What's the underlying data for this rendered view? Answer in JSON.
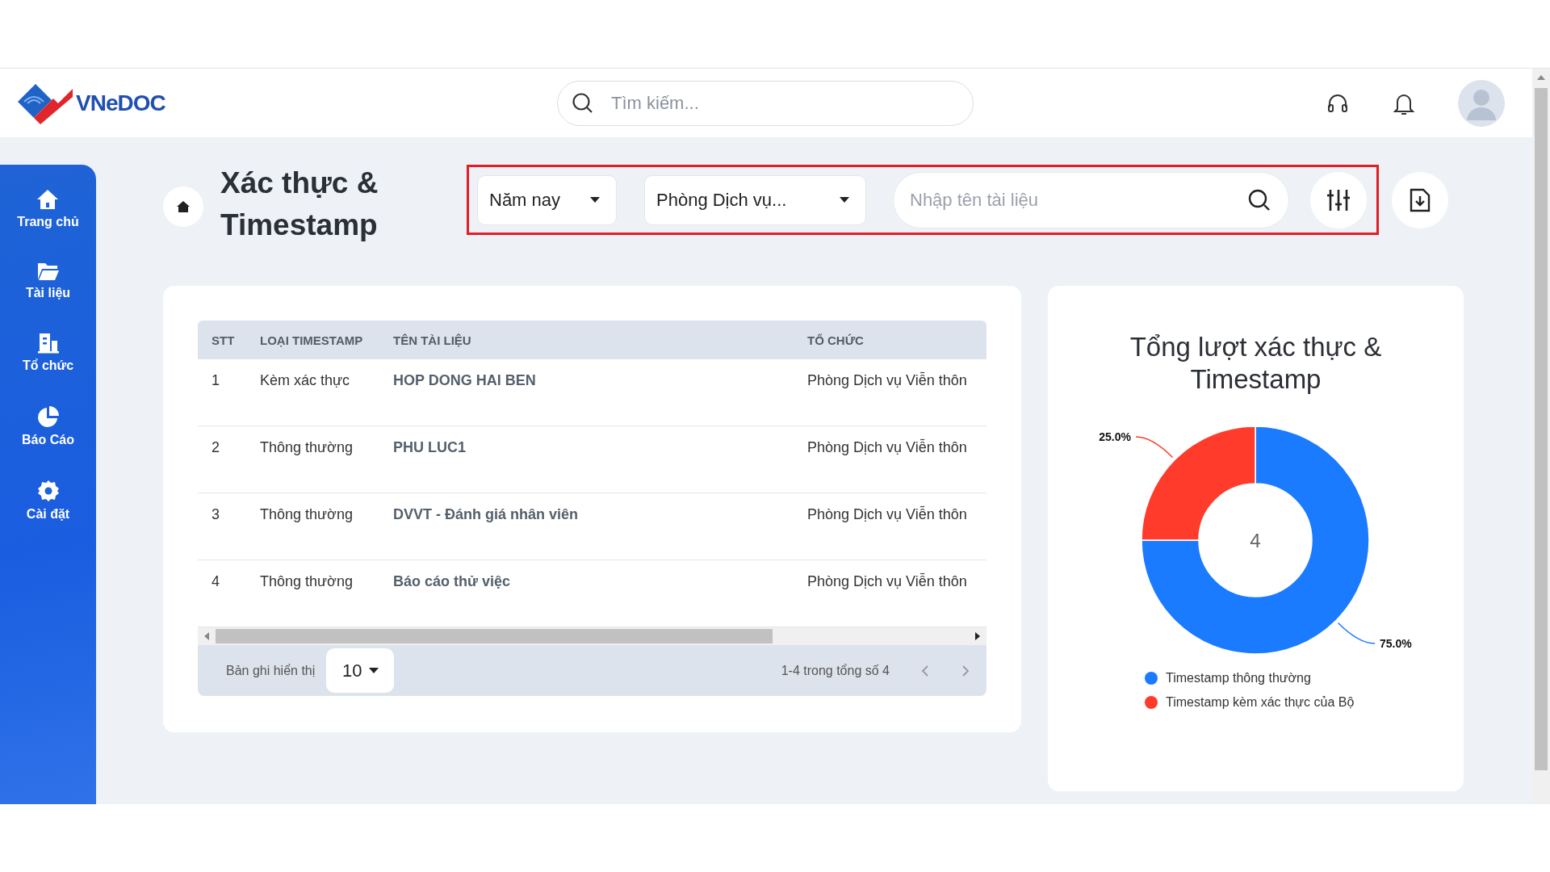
{
  "header": {
    "logo_text": "VNeDOC",
    "search": {
      "placeholder": "Tìm kiếm..."
    }
  },
  "sidebar": {
    "items": [
      {
        "label": "Trang chủ",
        "kind": "home"
      },
      {
        "label": "Tài liệu",
        "kind": "folder"
      },
      {
        "label": "Tổ chức",
        "kind": "building"
      },
      {
        "label": "Báo Cáo",
        "kind": "report"
      },
      {
        "label": "Cài đặt",
        "kind": "settings"
      }
    ]
  },
  "page_title": "Xác thực & Timestamp",
  "filters": {
    "year": "Năm nay",
    "department": "Phòng Dịch vụ...",
    "search": {
      "placeholder": "Nhập tên tài liệu"
    }
  },
  "table": {
    "columns": [
      "STT",
      "LOẠI TIMESTAMP",
      "TÊN TÀI LIỆU",
      "TỔ CHỨC"
    ],
    "rows": [
      {
        "stt": "1",
        "type": "Kèm xác thực",
        "name": "HOP DONG HAI BEN",
        "org": "Phòng Dịch vụ Viễn thôn"
      },
      {
        "stt": "2",
        "type": "Thông thường",
        "name": "PHU LUC1",
        "org": "Phòng Dịch vụ Viễn thôn"
      },
      {
        "stt": "3",
        "type": "Thông thường",
        "name": "DVVT - Đánh giá nhân viên",
        "org": "Phòng Dịch vụ Viễn thôn"
      },
      {
        "stt": "4",
        "type": "Thông thường",
        "name": "Báo cáo thử việc",
        "org": "Phòng Dịch vụ Viễn thôn"
      }
    ],
    "footer": {
      "page_size_label": "Bản ghi hiển thị",
      "page_size": "10",
      "range": "1-4 trong tổng số 4"
    }
  },
  "chart": {
    "title": "Tổng lượt xác thực & Timestamp",
    "total": "4",
    "chart_data": {
      "type": "donut",
      "categories": [
        "Timestamp thông thường",
        "Timestamp kèm xác thực của Bộ"
      ],
      "values": [
        75,
        25
      ],
      "value_labels": [
        "75.0%",
        "25.0%"
      ]
    },
    "legend": [
      {
        "color": "#1a7bff"
      },
      {
        "color": "#ff3b2b"
      }
    ]
  }
}
